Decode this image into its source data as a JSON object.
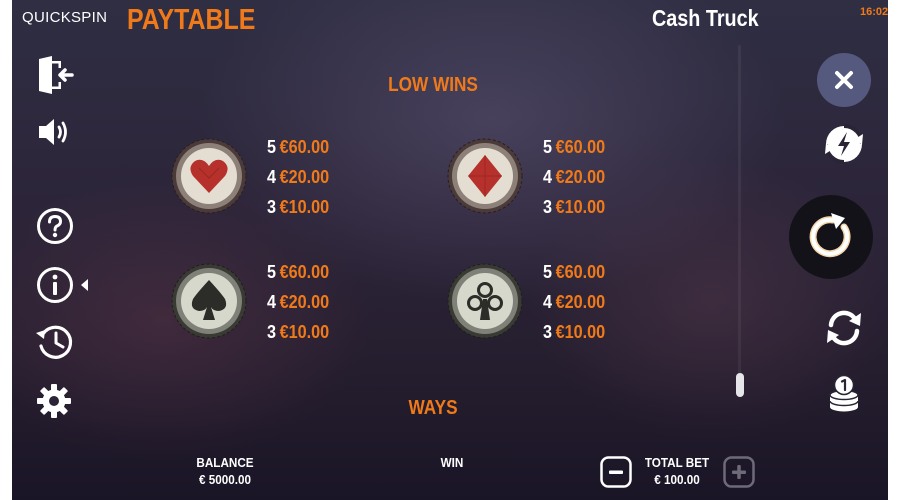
{
  "header": {
    "brand": "QUICKSPIN",
    "title": "PAYTABLE",
    "game_name": "Cash Truck",
    "clock": "16:02"
  },
  "colors": {
    "accent": "#f07a1a",
    "text": "#ffffff",
    "background": "#2a2538"
  },
  "sidebar": {
    "items": [
      {
        "icon": "exit-icon"
      },
      {
        "icon": "sound-icon"
      },
      {
        "icon": "help-icon"
      },
      {
        "icon": "info-icon"
      },
      {
        "icon": "history-icon"
      },
      {
        "icon": "settings-icon"
      }
    ]
  },
  "paytable": {
    "low_wins_heading": "LOW WINS",
    "ways_heading": "WAYS",
    "symbols": [
      {
        "icon": "heart-cap-icon",
        "pays": [
          {
            "count": "5",
            "amount": "€60.00"
          },
          {
            "count": "4",
            "amount": "€20.00"
          },
          {
            "count": "3",
            "amount": "€10.00"
          }
        ]
      },
      {
        "icon": "diamond-cap-icon",
        "pays": [
          {
            "count": "5",
            "amount": "€60.00"
          },
          {
            "count": "4",
            "amount": "€20.00"
          },
          {
            "count": "3",
            "amount": "€10.00"
          }
        ]
      },
      {
        "icon": "spade-cap-icon",
        "pays": [
          {
            "count": "5",
            "amount": "€60.00"
          },
          {
            "count": "4",
            "amount": "€20.00"
          },
          {
            "count": "3",
            "amount": "€10.00"
          }
        ]
      },
      {
        "icon": "club-cap-icon",
        "pays": [
          {
            "count": "5",
            "amount": "€60.00"
          },
          {
            "count": "4",
            "amount": "€20.00"
          },
          {
            "count": "3",
            "amount": "€10.00"
          }
        ]
      }
    ]
  },
  "controls": {
    "close": "close-icon",
    "turbo": "turbo-icon",
    "spin": "spin-icon",
    "autoplay": "autoplay-icon",
    "bet_stack": "coin-stack-icon"
  },
  "footer": {
    "balance_label": "BALANCE",
    "balance_value": "€ 5000.00",
    "win_label": "WIN",
    "total_bet_label": "TOTAL BET",
    "total_bet_value": "€ 100.00"
  }
}
